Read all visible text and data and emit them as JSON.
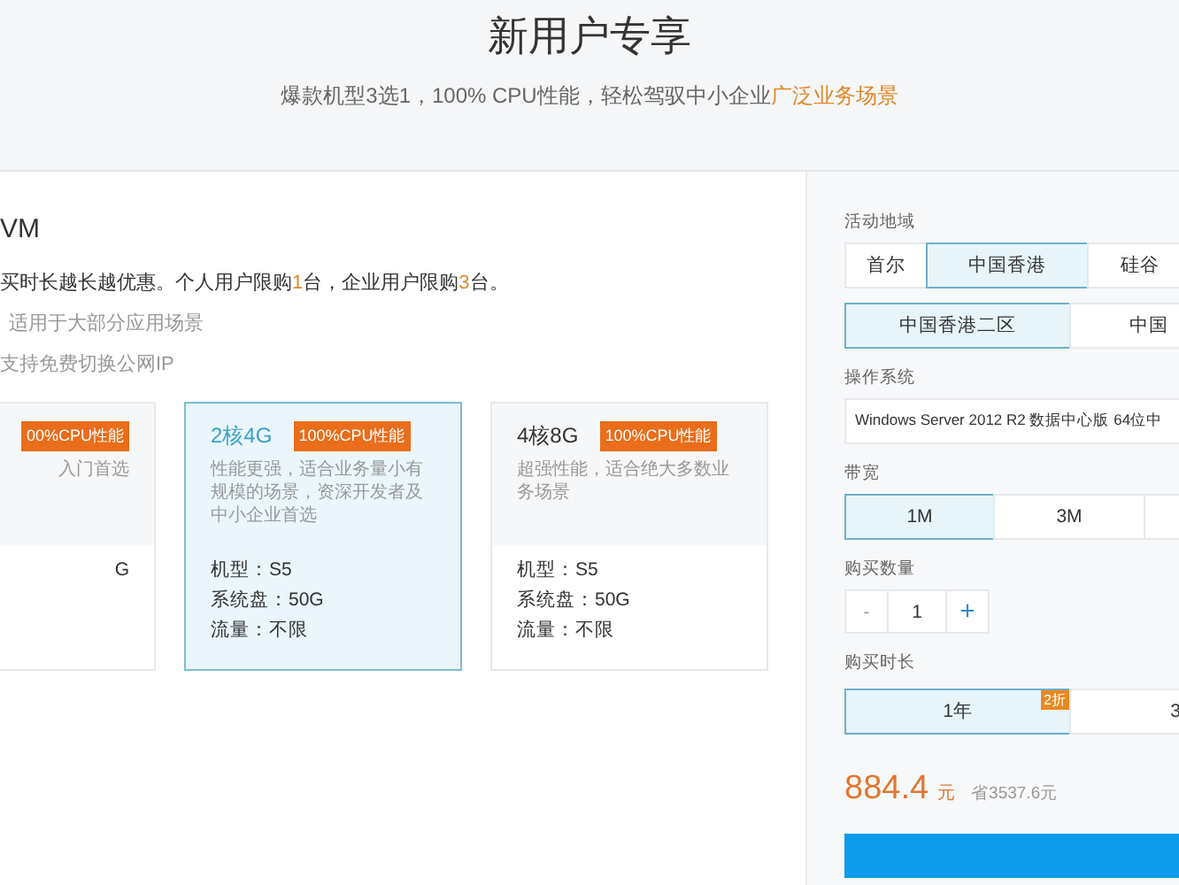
{
  "header": {
    "title": "新用户专享",
    "subtitle": [
      {
        "text": "爆款机型3选1，100% CPU性能，轻松驾驭中小企业",
        "highlight": false
      },
      {
        "text": "广泛业务场景",
        "highlight": true
      }
    ]
  },
  "product": {
    "title": "VM",
    "description": [
      {
        "text": "买时长越长越优惠。个人用户限购",
        "highlight": false
      },
      {
        "text": "1",
        "highlight": true
      },
      {
        "text": "台，企业用户限购",
        "highlight": false
      },
      {
        "text": "3",
        "highlight": true
      },
      {
        "text": "台。",
        "highlight": false
      }
    ],
    "features": [
      "适用于大部分应用场景",
      "支持免费切换公网IP"
    ],
    "plans": [
      {
        "badge": "00%CPU性能",
        "description": "入门首选",
        "specs": [
          "G"
        ],
        "selected": false
      },
      {
        "title": "2核4G",
        "badge": "100%CPU性能",
        "description": "性能更强，适合业务量小有规模的场景，资深开发者及中小企业首选",
        "specs": [
          "机型：S5",
          "系统盘：50G",
          "流量：不限"
        ],
        "selected": true
      },
      {
        "title": "4核8G",
        "badge": "100%CPU性能",
        "description": "超强性能，适合绝大多数业务场景",
        "specs": [
          "机型：S5",
          "系统盘：50G",
          "流量：不限"
        ],
        "selected": false
      }
    ]
  },
  "order": {
    "region_label": "活动地域",
    "regions": [
      {
        "label": "首尔",
        "selected": false
      },
      {
        "label": "中国香港",
        "selected": true
      },
      {
        "label": "硅谷",
        "selected": false
      }
    ],
    "zones": [
      {
        "label": "中国香港二区",
        "selected": true
      },
      {
        "label": "中国",
        "selected": false
      }
    ],
    "os_label": "操作系统",
    "os_value": "Windows Server 2012 R2 数据中心版 64位中",
    "bandwidth_label": "带宽",
    "bandwidths": [
      {
        "label": "1M",
        "selected": true
      },
      {
        "label": "3M",
        "selected": false
      },
      {
        "selected": false
      }
    ],
    "quantity_label": "购买数量",
    "quantity": {
      "minus": "-",
      "value": "1",
      "plus": "+"
    },
    "duration_label": "购买时长",
    "durations": [
      {
        "label": "1年",
        "badge": "2折",
        "selected": true
      },
      {
        "label": "3",
        "selected": false
      }
    ],
    "price": "884.4",
    "price_unit": "元",
    "saving": "省3537.6元"
  }
}
